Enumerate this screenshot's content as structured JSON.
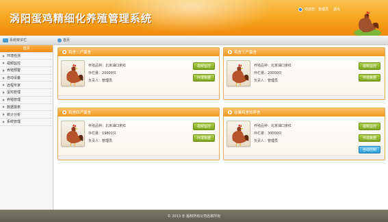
{
  "header": {
    "title": "涡阳蛋鸡精细化养殖管理系统",
    "welcome": "欢迎您：管理员",
    "logout": "退出"
  },
  "subbar": {
    "menu_title": "系统菜单栏",
    "breadcrumb": "首页"
  },
  "sidebar": {
    "items": [
      {
        "label": "首页",
        "active": true
      },
      {
        "label": "环境检测"
      },
      {
        "label": "视频监控"
      },
      {
        "label": "养殖预警"
      },
      {
        "label": "自动设备"
      },
      {
        "label": "远程专家"
      },
      {
        "label": "蛋鸡管理"
      },
      {
        "label": "养殖管理"
      },
      {
        "label": "数据报表"
      },
      {
        "label": "统计分析"
      },
      {
        "label": "系统管理"
      }
    ]
  },
  "cards": [
    {
      "title": "鸡舍二产蛋舍",
      "breed_label": "养殖品种：",
      "breed": "北京油口京红",
      "stock_label": "存栏量：",
      "stock": "20000只",
      "manager_label": "负责人：",
      "manager": "管理员",
      "buttons": [
        "视频监控",
        "环境数据"
      ]
    },
    {
      "title": "鸡舍三产蛋舍",
      "breed_label": "养殖品种：",
      "breed": "北京油口京红",
      "stock_label": "存栏量：",
      "stock": "20000只",
      "manager_label": "负责人：",
      "manager": "管理员",
      "buttons": [
        "视频监控",
        "环境数据"
      ]
    },
    {
      "title": "鸡舍四产蛋舍",
      "breed_label": "养殖品种：",
      "breed": "北京油口京红",
      "stock_label": "存栏量：",
      "stock": "19801只",
      "manager_label": "负责人：",
      "manager": "管理员",
      "buttons": [
        "视频监控",
        "环境数据"
      ]
    },
    {
      "title": "幼雏鸡舍饲养舍",
      "breed_label": "养殖品种：",
      "breed": "北京油口京红",
      "stock_label": "存栏量：",
      "stock": "30000只",
      "manager_label": "负责人：",
      "manager": "管理员",
      "buttons": [
        "视频监控",
        "环境数据",
        "自动控制"
      ]
    }
  ],
  "footer": {
    "copyright": "© 2013 年 版权所有公司名称所有"
  },
  "colors": {
    "brand_orange": "#f6a21c",
    "button_green": "#7ca41a",
    "button_blue": "#2a9ad6"
  }
}
